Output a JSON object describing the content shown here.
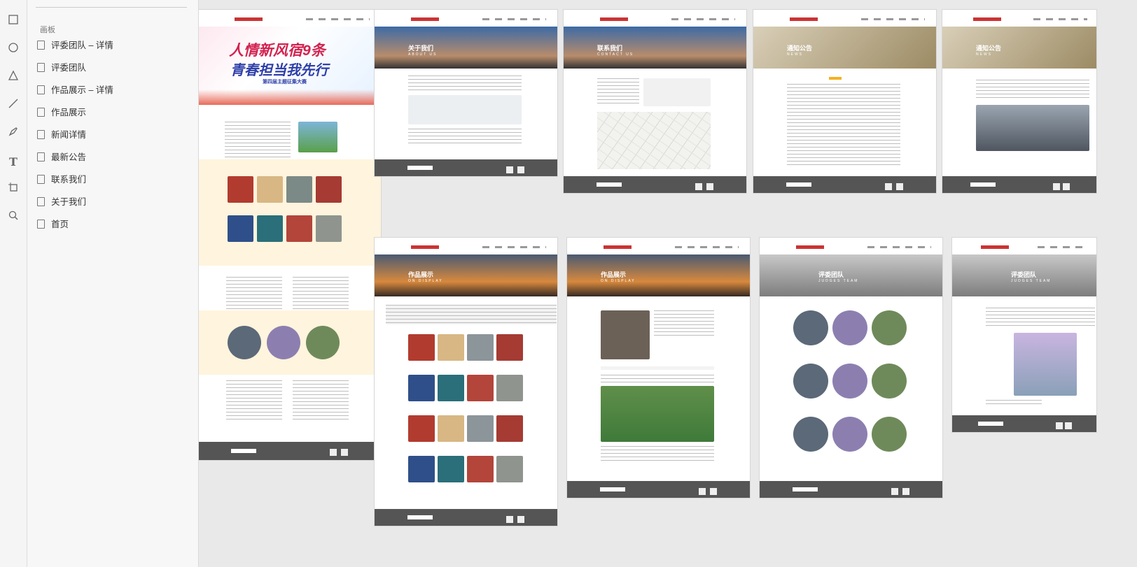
{
  "panel": {
    "section_label": "画板",
    "items": [
      {
        "label": "评委团队 – 详情"
      },
      {
        "label": "评委团队"
      },
      {
        "label": "作品展示 – 详情"
      },
      {
        "label": "作品展示"
      },
      {
        "label": "新闻详情"
      },
      {
        "label": "最新公告"
      },
      {
        "label": "联系我们"
      },
      {
        "label": "关于我们"
      },
      {
        "label": "首页"
      }
    ]
  },
  "tools": [
    "rectangle-icon",
    "ellipse-icon",
    "triangle-icon",
    "line-icon",
    "pen-icon",
    "text-icon",
    "artboard-icon",
    "zoom-icon"
  ],
  "artboards": {
    "home": {
      "banner_line1": "人情新风宿9条",
      "banner_line2": "青春担当我先行",
      "banner_sub": "第四届主题征集大赛"
    },
    "about": {
      "title": "关于我们",
      "subtitle": "ABOUT US"
    },
    "contact": {
      "title": "联系我们",
      "subtitle": "CONTACT US"
    },
    "notice": {
      "title": "通知公告",
      "subtitle": "NEWS"
    },
    "news_detail": {
      "title": "通知公告",
      "subtitle": "NEWS"
    },
    "works": {
      "title": "作品展示",
      "subtitle": "ON DISPLAY"
    },
    "works_detail": {
      "title": "作品展示",
      "subtitle": "ON DISPLAY"
    },
    "judges": {
      "title": "评委团队",
      "subtitle": "JUDGES TEAM"
    },
    "judges_detail": {
      "title": "评委团队",
      "subtitle": "JUDGES TEAM"
    }
  },
  "colors": {
    "accent": "#f5b120",
    "footer": "#555555",
    "cream": "#fff4dd",
    "brand_red": "#c33333"
  }
}
